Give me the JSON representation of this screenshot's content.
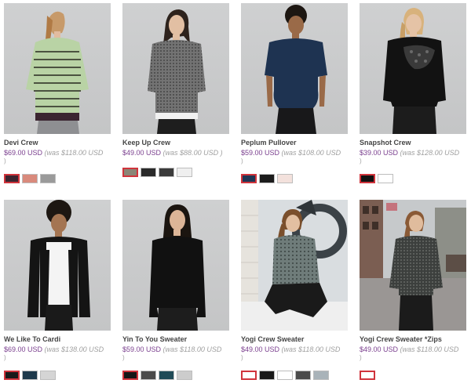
{
  "products": [
    {
      "name": "Devi Crew",
      "price": "$69.00 USD",
      "was": "(was $118.00 USD",
      "was_close": ")",
      "swatches": [
        "#3b2530",
        "#d98a7c",
        "#9a9a9a"
      ],
      "image": "woman-striped-green-sweater"
    },
    {
      "name": "Keep Up Crew",
      "price": "$49.00 USD",
      "was": "(was $88.00 USD )",
      "was_close": "",
      "swatches": [
        "#8b8677",
        "#2a2a2a",
        "#3b3b3b",
        "#efefef"
      ],
      "image": "woman-grey-crew-sweater"
    },
    {
      "name": "Peplum Pullover",
      "price": "$59.00 USD",
      "was": "(was $108.00 USD",
      "was_close": ")",
      "swatches": [
        "#1f3654",
        "#1c1c1c",
        "#f3e1dc"
      ],
      "image": "woman-navy-peplum-top"
    },
    {
      "name": "Snapshot Crew",
      "price": "$39.00 USD",
      "was": "(was $128.00 USD",
      "was_close": ")",
      "swatches": [
        "#111111",
        "#ffffff"
      ],
      "image": "woman-black-lace-crew"
    },
    {
      "name": "We Like To Cardi",
      "price": "$69.00 USD",
      "was": "(was $138.00 USD",
      "was_close": ")",
      "swatches": [
        "#1a1a1a",
        "#1f3a4c",
        "#d5d5d5"
      ],
      "image": "woman-black-cardigan"
    },
    {
      "name": "Yin To You Sweater",
      "price": "$59.00 USD",
      "was": "(was $118.00 USD",
      "was_close": ")",
      "swatches": [
        "#161616",
        "#4a4a4a",
        "#1f4a56",
        "#cccccc"
      ],
      "image": "woman-black-sweater"
    },
    {
      "name": "Yogi Crew Sweater",
      "price": "$49.00 USD",
      "was": "(was $118.00 USD",
      "was_close": ")",
      "swatches": [
        "#ffffff",
        "#1a1a1a",
        "#ffffff",
        "#4b4b4b",
        "#a9b3b9"
      ],
      "image": "woman-seated-knit-sweater"
    },
    {
      "name": "Yogi Crew Sweater *Zips",
      "price": "$49.00 USD",
      "was": "(was $118.00 USD",
      "was_close": ")",
      "swatches": [
        "#ffffff"
      ],
      "image": "woman-street-knit-sweater"
    }
  ]
}
